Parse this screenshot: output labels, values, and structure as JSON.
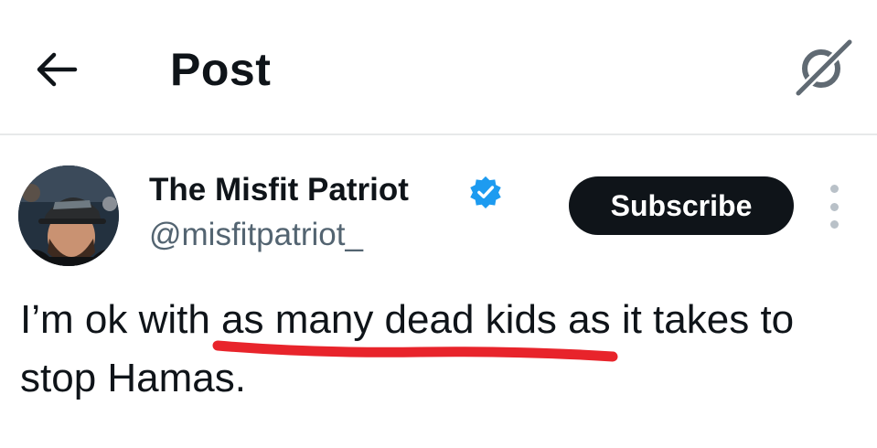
{
  "header": {
    "title": "Post",
    "back_icon": "arrow-left-icon",
    "grok_icon": "grok-icon"
  },
  "post": {
    "author": {
      "name": "The Misfit Patriot",
      "handle": "@misfitpatriot_",
      "verified": true,
      "verified_color": "#1d9bf0"
    },
    "subscribe_label": "Subscribe",
    "more_icon": "more-vertical-icon",
    "text": "I’m ok with as many dead kids as it takes to stop Hamas.",
    "annotation": {
      "type": "hand-drawn underline",
      "color": "#e8242b",
      "underlined_text": "as many dead kids"
    }
  }
}
